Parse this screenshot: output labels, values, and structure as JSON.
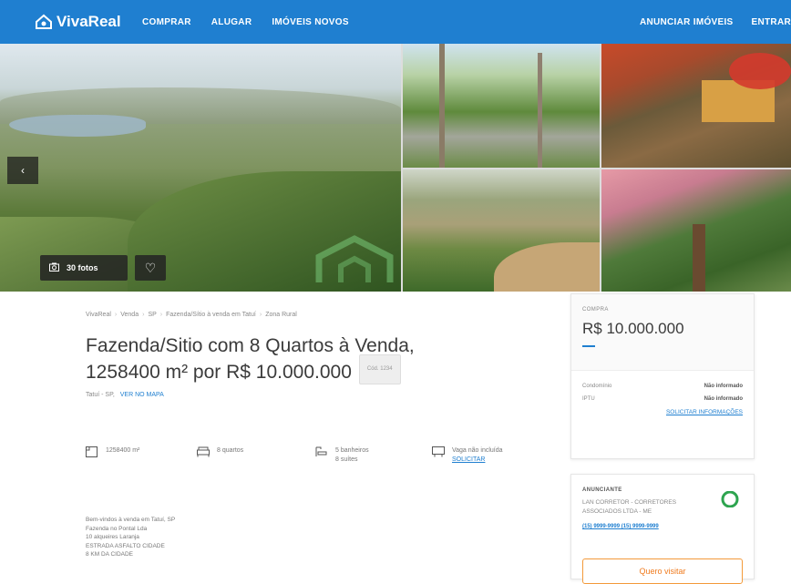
{
  "header": {
    "logo_text": "VivaReal",
    "nav": [
      "COMPRAR",
      "ALUGAR",
      "IMÓVEIS NOVOS"
    ],
    "nav_right": [
      "ANUNCIAR IMÓVEIS",
      "ENTRAR"
    ],
    "brand_color": "#1f7fd0"
  },
  "gallery": {
    "photos_label": "30 fotos",
    "prev_icon": "chevron-left-icon",
    "favorite_icon": "heart-icon"
  },
  "breadcrumb": [
    "VivaReal",
    "Venda",
    "SP",
    "Fazenda/Sítio à venda em Tatuí",
    "Zona Rural"
  ],
  "title": "Fazenda/Sitio com 8 Quartos à Venda, 1258400 m² por R$ 10.000.000",
  "code_badge": "Cód. 1234",
  "location": {
    "text": "Tatuí - SP,",
    "map_link": "VER NO MAPA"
  },
  "features": [
    {
      "icon": "area-icon",
      "line1": "1258400 m²",
      "line2": ""
    },
    {
      "icon": "bed-icon",
      "line1": "8 quartos",
      "line2": ""
    },
    {
      "icon": "bath-icon",
      "line1": "5 banheiros",
      "line2": "8 suítes"
    },
    {
      "icon": "parking-icon",
      "line1": "Vaga não incluída",
      "line2": "",
      "link": "SOLICITAR"
    }
  ],
  "description": [
    "Bem-vindos à venda em Tatuí, SP",
    "Fazenda no Pontal Lda",
    "10 alqueires Laranja",
    "ESTRADA ASFALTO CIDADE",
    "8 KM DA CIDADE"
  ],
  "price_card": {
    "label": "COMPRA",
    "price": "R$ 10.000.000",
    "rows": [
      {
        "label": "Condomínio",
        "value": "Não informado"
      },
      {
        "label": "IPTU",
        "value": "Não informado"
      }
    ],
    "link": "SOLICITAR INFORMAÇÕES"
  },
  "agent_card": {
    "label": "ANUNCIANTE",
    "name_line1": "LAN CORRETOR - CORRETORES",
    "name_line2": "ASSOCIADOS LTDA - ME",
    "phone": "(15) 9999-9999 (15) 9999-9999",
    "button": "Quero visitar"
  }
}
